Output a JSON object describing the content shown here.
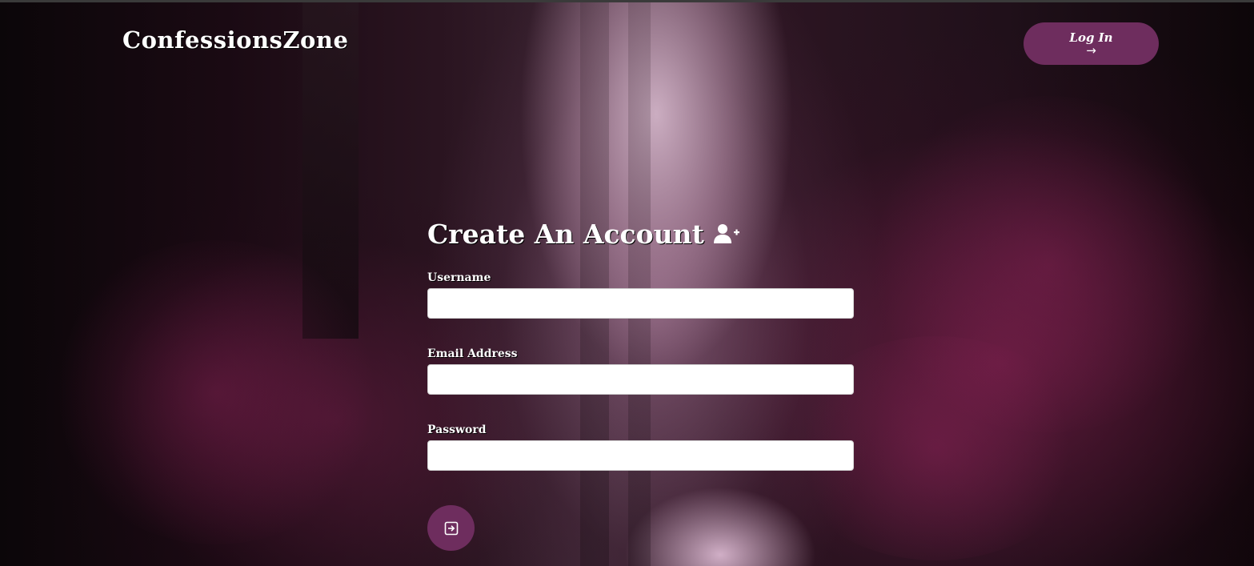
{
  "header": {
    "logo_text": "ConfessionsZone",
    "login_button": {
      "label": "Log In",
      "arrow": "→",
      "icon": "arrow-right-icon"
    }
  },
  "form": {
    "title": "Create An Account",
    "title_icon": "user-plus-icon",
    "fields": [
      {
        "label": "Username",
        "value": "",
        "placeholder": ""
      },
      {
        "label": "Email Address",
        "value": "",
        "placeholder": ""
      },
      {
        "label": "Password",
        "value": "",
        "placeholder": ""
      }
    ],
    "submit_icon": "sign-in-icon"
  },
  "colors": {
    "accent": "#6e2d5e",
    "text": "#ffffff",
    "input_background": "#ffffff"
  }
}
